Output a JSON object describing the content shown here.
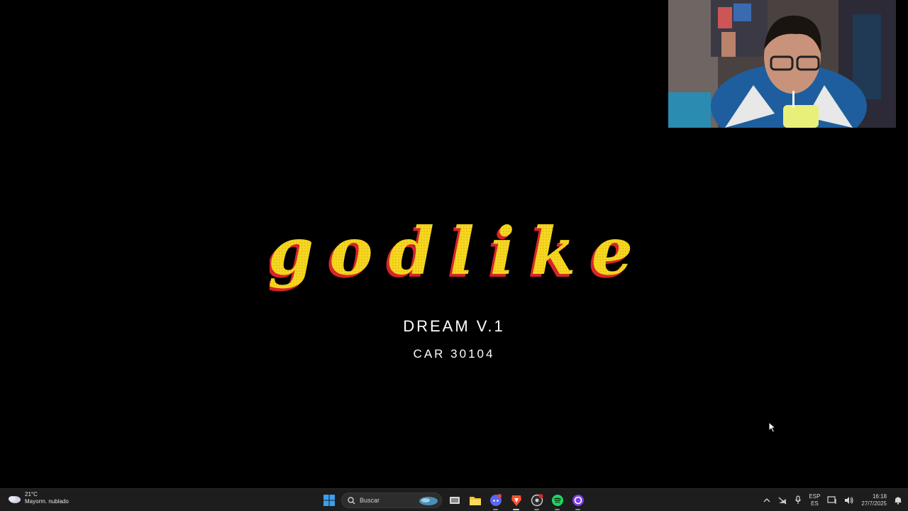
{
  "main": {
    "logo_text": "godlike",
    "title": "DREAM V.1",
    "code": "CAR 30104"
  },
  "taskbar": {
    "weather": {
      "temp": "21°C",
      "desc": "Mayorm. nublado",
      "icon": "partly-cloudy-icon"
    },
    "search": {
      "placeholder": "Buscar"
    },
    "apps": [
      {
        "name": "start-button",
        "icon": "windows-logo-icon"
      },
      {
        "name": "task-view",
        "icon": "task-view-icon"
      },
      {
        "name": "file-explorer",
        "icon": "folder-icon"
      },
      {
        "name": "discord",
        "icon": "discord-icon"
      },
      {
        "name": "brave",
        "icon": "brave-lion-icon"
      },
      {
        "name": "obs",
        "icon": "record-icon"
      },
      {
        "name": "spotify",
        "icon": "spotify-icon"
      },
      {
        "name": "app",
        "icon": "circle-app-icon"
      }
    ],
    "tray": {
      "lang_top": "ESP",
      "lang_bottom": "ES",
      "time": "16:18",
      "date": "27/7/2025"
    }
  },
  "colors": {
    "logo_fill": "#f2d41f",
    "logo_shadow": "#d8242a",
    "taskbar_bg": "#1d1d1d"
  }
}
